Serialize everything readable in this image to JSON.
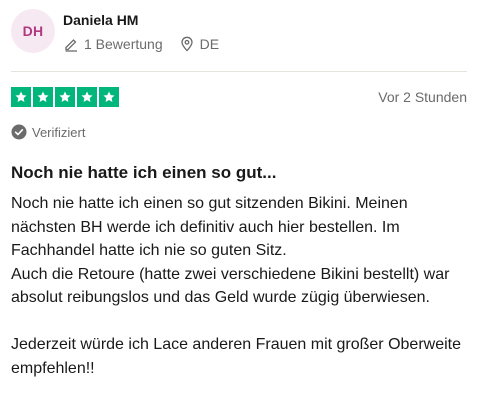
{
  "reviewer": {
    "initials": "DH",
    "name": "Daniela HM",
    "review_count": "1 Bewertung",
    "country": "DE",
    "pencil_icon": "pencil-icon",
    "location_icon": "location-pin-icon"
  },
  "review": {
    "rating": 5,
    "rating_max": 5,
    "time": "Vor 2 Stunden",
    "verified_label": "Verifiziert",
    "title": "Noch nie hatte ich einen so gut...",
    "text": "Noch nie hatte ich einen so gut sitzenden Bikini. Meinen nächsten BH werde ich definitiv auch hier bestellen. Im Fachhandel hatte ich nie so guten Sitz.\nAuch die Retoure (hatte zwei verschiedene Bikini bestellt) war absolut reibungslos und das Geld wurde zügig überwiesen.\n\nJederzeit würde ich Lace anderen Frauen mit großer Oberweite empfehlen!!"
  },
  "colors": {
    "star_green": "#00b67a",
    "avatar_bg": "#f6e9f2",
    "avatar_text": "#b0397f",
    "muted_text": "#6b6b6b"
  }
}
